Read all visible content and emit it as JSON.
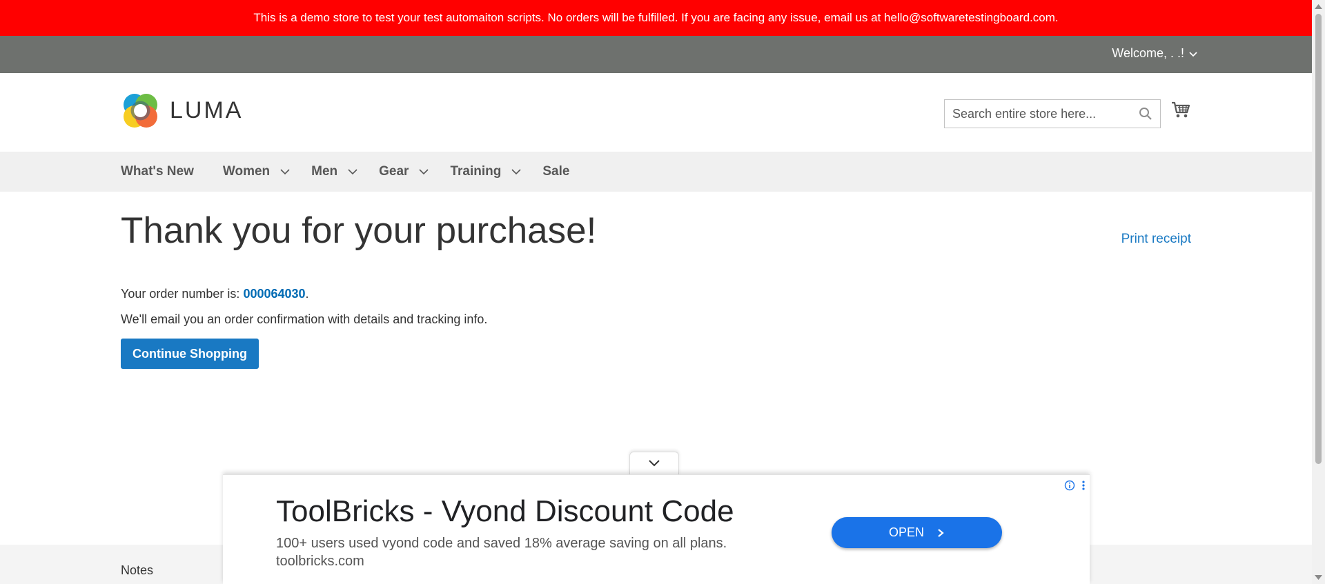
{
  "banner": {
    "text": "This is a demo store to test your test automaiton scripts. No orders will be fulfilled. If you are facing any issue, email us at hello@softwaretestingboard.com."
  },
  "header_panel": {
    "welcome": "Welcome, . .!"
  },
  "brand": {
    "name": "LUMA"
  },
  "search": {
    "placeholder": "Search entire store here..."
  },
  "nav": {
    "items": [
      {
        "label": "What's New"
      },
      {
        "label": "Women"
      },
      {
        "label": "Men"
      },
      {
        "label": "Gear"
      },
      {
        "label": "Training"
      },
      {
        "label": "Sale"
      }
    ]
  },
  "main": {
    "title": "Thank you for your purchase!",
    "print_receipt": "Print receipt",
    "order_prefix": "Your order number is: ",
    "order_number": "000064030",
    "order_suffix": ".",
    "email_note": "We'll email you an order confirmation with details and tracking info.",
    "continue_label": "Continue Shopping"
  },
  "footer": {
    "notes": "Notes"
  },
  "ad": {
    "title": "ToolBricks - Vyond Discount Code",
    "description": "100+ users used vyond code and saved 18% average saving on all plans.",
    "domain": "toolbricks.com",
    "cta": "OPEN"
  },
  "colors": {
    "banner_bg": "#ff0000",
    "panel_bg": "#6e716e",
    "nav_bg": "#f0f0f0",
    "primary": "#1979c3",
    "link": "#006bb4",
    "ad_cta": "#1a73e8"
  },
  "icons": [
    "chevron-down-icon",
    "luma-logo-icon",
    "search-icon",
    "cart-icon",
    "info-icon",
    "menu-dots-icon",
    "chevron-right-icon"
  ]
}
